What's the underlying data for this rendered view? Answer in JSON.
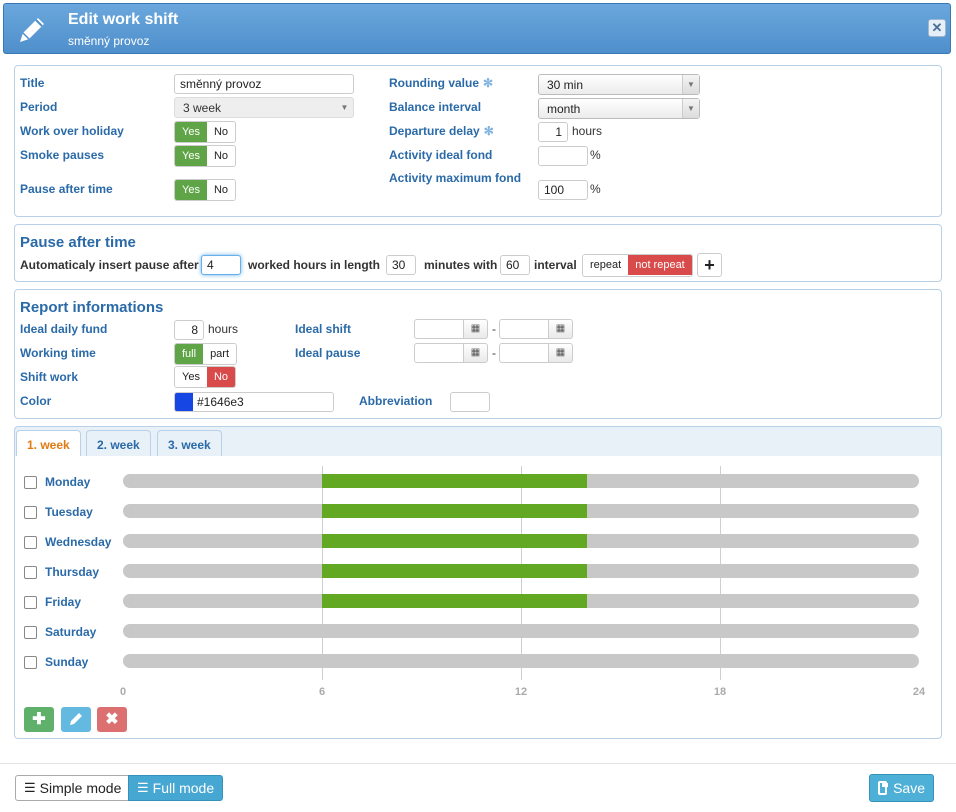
{
  "header": {
    "title": "Edit work shift",
    "subtitle": "směnný provoz",
    "close_icon": "close-icon"
  },
  "general": {
    "title_label": "Title",
    "title_value": "směnný provoz",
    "period_label": "Period",
    "period_value": "3 week",
    "holiday_label": "Work over holiday",
    "smoke_label": "Smoke pauses",
    "pause_label": "Pause after time",
    "yes": "Yes",
    "no": "No",
    "rounding_label": "Rounding value",
    "rounding_value": "30 min",
    "balance_label": "Balance interval",
    "balance_value": "month",
    "delay_label": "Departure delay",
    "delay_value": "1",
    "hours": "hours",
    "ideal_fond_label": "Activity ideal fond",
    "ideal_fond_value": "",
    "percent": "%",
    "max_fond_label": "Activity maximum fond",
    "max_fond_value": "100"
  },
  "pause": {
    "heading": "Pause after time",
    "text1": "Automaticaly insert pause after",
    "after_value": "4",
    "text2": "worked hours in length",
    "length_value": "30",
    "text3": "minutes with",
    "with_value": "60",
    "text4": "interval",
    "repeat": "repeat",
    "not_repeat": "not repeat",
    "add": "+"
  },
  "report": {
    "heading": "Report informations",
    "daily_label": "Ideal daily fund",
    "daily_value": "8",
    "hours": "hours",
    "working_label": "Working time",
    "full": "full",
    "part": "part",
    "shift_label": "Shift work",
    "yes": "Yes",
    "no": "No",
    "color_label": "Color",
    "color_value": "#1646e3",
    "ideal_shift_label": "Ideal shift",
    "ideal_pause_label": "Ideal pause",
    "dash": "-",
    "abbr_label": "Abbreviation"
  },
  "tabs": [
    "1. week",
    "2. week",
    "3. week"
  ],
  "days": [
    {
      "name": "Monday",
      "start": 6,
      "end": 14
    },
    {
      "name": "Tuesday",
      "start": 6,
      "end": 14
    },
    {
      "name": "Wednesday",
      "start": 6,
      "end": 14
    },
    {
      "name": "Thursday",
      "start": 6,
      "end": 14
    },
    {
      "name": "Friday",
      "start": 6,
      "end": 14
    },
    {
      "name": "Saturday",
      "start": null,
      "end": null
    },
    {
      "name": "Sunday",
      "start": null,
      "end": null
    }
  ],
  "axis": [
    "0",
    "6",
    "12",
    "18",
    "24"
  ],
  "footer": {
    "simple": "Simple mode",
    "full": "Full mode",
    "save": "Save"
  },
  "colors": {
    "accent": "#2a6aa8",
    "bar": "#62a823",
    "active_tab": "#e07a12"
  }
}
